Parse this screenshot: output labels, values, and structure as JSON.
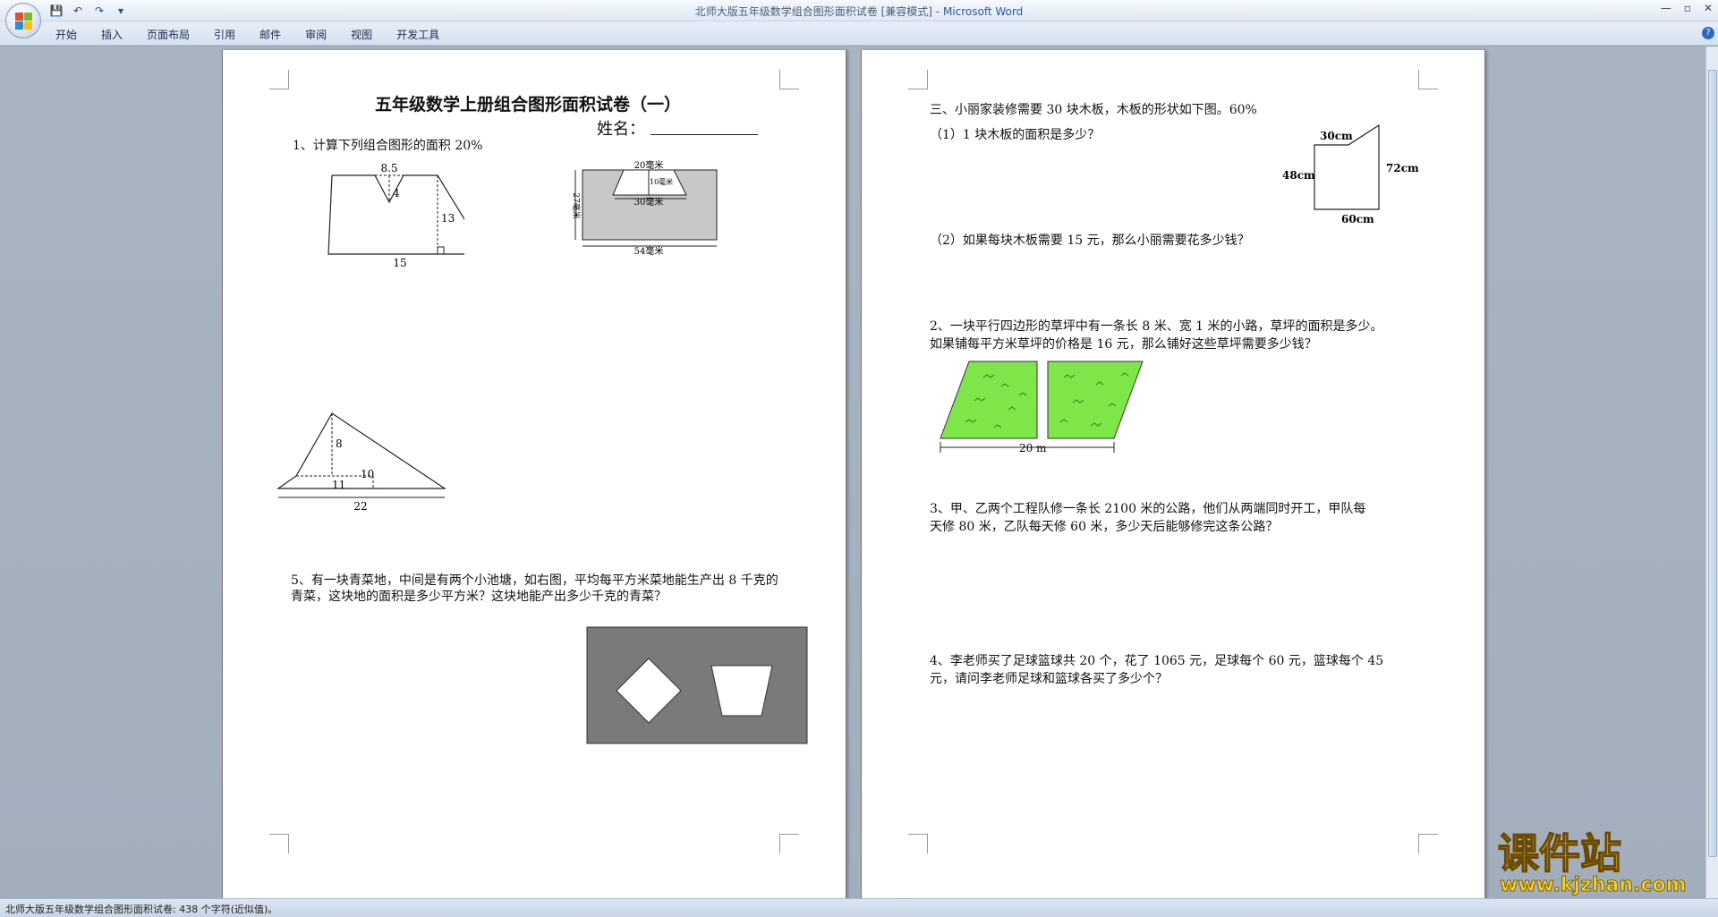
{
  "window": {
    "title_doc": "北师大版五年级数学组合图形面积试卷 [兼容模式]",
    "title_sep": " - ",
    "title_app": "Microsoft Word",
    "minimize": "—",
    "maximize": "▫",
    "close": "✕",
    "help": "?"
  },
  "qat": {
    "save": "💾",
    "undo": "↶",
    "redo": "↷",
    "more": "▾"
  },
  "tabs": [
    "开始",
    "插入",
    "页面布局",
    "引用",
    "邮件",
    "审阅",
    "视图",
    "开发工具"
  ],
  "status": {
    "text": "北师大版五年级数学组合图形面积试卷: 438 个字符(近似值)。"
  },
  "left_page": {
    "title": "五年级数学上册组合图形面积试卷（一）",
    "name_label": "姓名：",
    "q1": "1、计算下列组合图形的面积 20%",
    "fig1": {
      "top": "8.5",
      "inner": "4",
      "height": "13",
      "bottom": "15"
    },
    "fig2": {
      "top": "20毫米",
      "depth": "10毫米",
      "mid": "30毫米",
      "side": "27毫米",
      "bottom": "54毫米"
    },
    "fig3": {
      "h1": "8",
      "w1": "11",
      "h2": "10",
      "bottom": "22"
    },
    "q5_line1": "5、有一块青菜地，中间是有两个小池塘，如右图，平均每平方米菜地能生产出 8 千克的",
    "q5_line2": "青菜，这块地的面积是多少平方米？这块地能产出多少千克的青菜？"
  },
  "right_page": {
    "q3_title": "三、小丽家装修需要 30 块木板，木板的形状如下图。60%",
    "q3_1": "（1）1 块木板的面积是多少？",
    "q3_2": "（2）如果每块木板需要 15 元，那么小丽需要花多少钱？",
    "board": {
      "top": "30cm",
      "left": "48cm",
      "right": "72cm",
      "bottom": "60cm"
    },
    "q2_line1": "2、一块平行四边形的草坪中有一条长 8 米、宽 1 米的小路，草坪的面积是多少。",
    "q2_line2": "如果铺每平方米草坪的价格是 16 元，那么铺好这些草坪需要多少钱？",
    "lawn_label": "20 m",
    "q3b_line1": "3、甲、乙两个工程队修一条长 2100 米的公路，他们从两端同时开工，甲队每",
    "q3b_line2": "天修 80 米，乙队每天修 60 米，多少天后能够修完这条公路？",
    "q4_line1": "4、李老师买了足球篮球共 20 个，花了 1065 元，足球每个 60 元，篮球每个 45",
    "q4_line2": "元，请问李老师足球和篮球各买了多少个？"
  },
  "watermark": {
    "title": "课件站",
    "url": "www.kjzhan.com"
  }
}
